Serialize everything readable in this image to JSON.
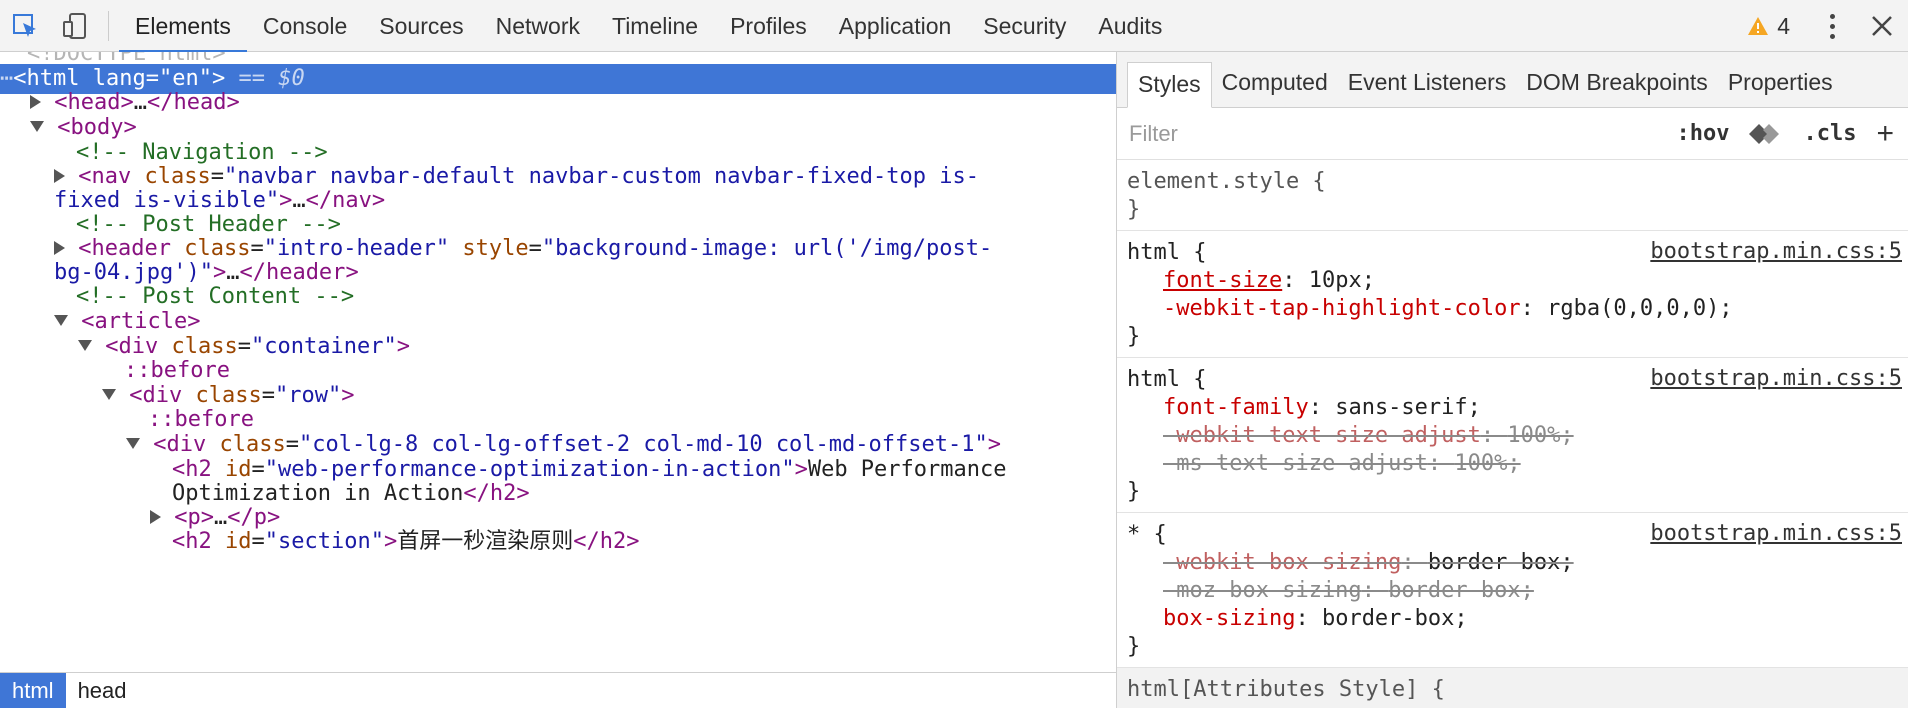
{
  "toolbar": {
    "tabs": [
      "Elements",
      "Console",
      "Sources",
      "Network",
      "Timeline",
      "Profiles",
      "Application",
      "Security",
      "Audits"
    ],
    "active_tab": "Elements",
    "warning_count": "4"
  },
  "dom": {
    "doctype": "<!DOCTYPE html>",
    "selected_marker": "== $0",
    "html_tag": "html",
    "lang_attr": "lang",
    "lang_value": "en",
    "head_tag": "head",
    "body_tag": "body",
    "comment_nav": "<!-- Navigation -->",
    "nav_tag": "nav",
    "nav_class_1": "navbar navbar-default navbar-custom navbar-fixed-top is-",
    "nav_class_2": "fixed is-visible",
    "comment_header": "<!-- Post Header -->",
    "header_tag": "header",
    "header_class": "intro-header",
    "header_style_1": "background-image: url('/img/post-",
    "header_style_2": "bg-04.jpg')",
    "comment_content": "<!-- Post Content -->",
    "article_tag": "article",
    "div_tag": "div",
    "container_class": "container",
    "before_pseudo": "::before",
    "row_class": "row",
    "col_class": "col-lg-8 col-lg-offset-2 col-md-10 col-md-offset-1",
    "h2_tag": "h2",
    "h2_id": "web-performance-optimization-in-action",
    "h2_text_1": "Web Performance",
    "h2_text_2": "Optimization in Action",
    "p_tag": "p",
    "h2b_id": "section",
    "h2b_text": "首屏一秒渲染原则",
    "ellipsis": "…",
    "attr_class": "class",
    "attr_style": "style",
    "attr_id": "id"
  },
  "breadcrumbs": [
    "html",
    "head"
  ],
  "styles": {
    "tabs": [
      "Styles",
      "Computed",
      "Event Listeners",
      "DOM Breakpoints",
      "Properties"
    ],
    "active_tab": "Styles",
    "filter_placeholder": "Filter",
    "hov_label": ":hov",
    "cls_label": ".cls",
    "plus_label": "+",
    "rules": [
      {
        "selector": "element.style {",
        "close": "}"
      },
      {
        "selector": "html {",
        "source": "bootstrap.min.css:5",
        "close": "}",
        "decls": [
          {
            "prop": "font-size",
            "value": "10px;"
          },
          {
            "prop": "-webkit-tap-highlight-color",
            "value": "rgba(0,0,0,0);"
          }
        ]
      },
      {
        "selector": "html {",
        "source": "bootstrap.min.css:5",
        "close": "}",
        "decls": [
          {
            "prop": "font-family",
            "value": "sans-serif;"
          },
          {
            "prop": "-webkit-text-size-adjust",
            "value": "100%;"
          },
          {
            "prop": "-ms-text-size-adjust",
            "value": "100%;"
          }
        ]
      },
      {
        "selector": "* {",
        "source": "bootstrap.min.css:5",
        "close": "}",
        "decls": [
          {
            "prop": "-webkit-box-sizing",
            "value": "border-box;"
          },
          {
            "prop": "-moz-box-sizing",
            "value": "border-box;"
          },
          {
            "prop": "box-sizing",
            "value": "border-box;"
          }
        ]
      },
      {
        "selector": "html[Attributes Style] {"
      }
    ]
  },
  "colors": {
    "accent": "#3f76d6",
    "tag": "#881280",
    "attr_name": "#994500",
    "attr_value": "#1a1aa6",
    "comment": "#236e25",
    "css_property": "#c80000",
    "warning": "#f5a623"
  }
}
